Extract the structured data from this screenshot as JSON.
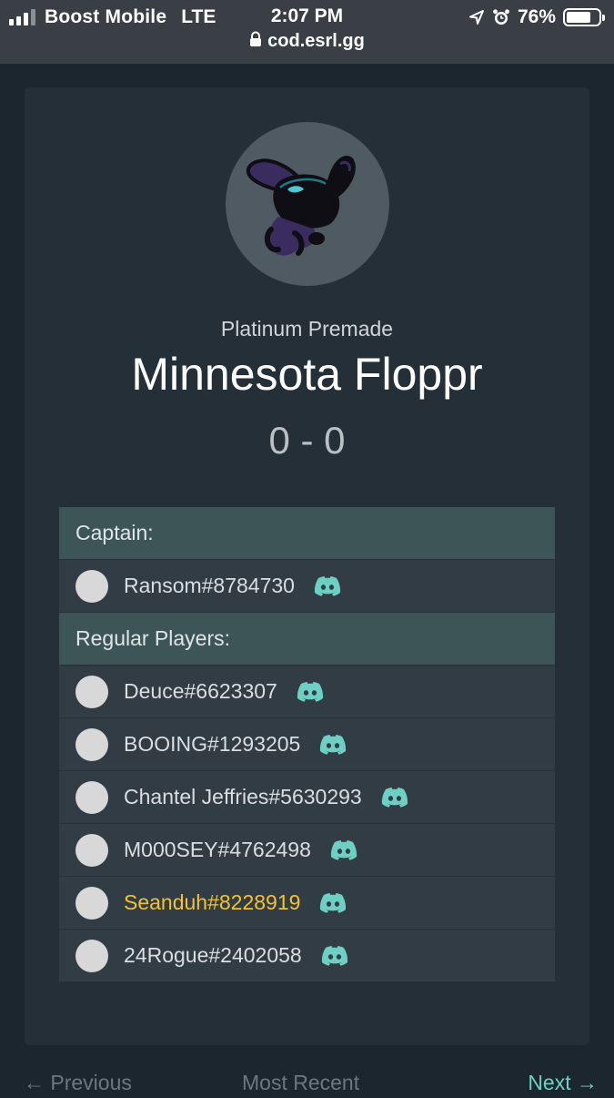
{
  "status_bar": {
    "carrier": "Boost Mobile",
    "network": "LTE",
    "time": "2:07 PM",
    "battery": "76%",
    "battery_level": 0.76,
    "url": "cod.esrl.gg"
  },
  "team": {
    "division": "Platinum Premade",
    "name": "Minnesota Floppr",
    "record": "0 - 0"
  },
  "roster": {
    "captain_header": "Captain:",
    "captain": {
      "name": "Ransom#8784730",
      "highlight": false
    },
    "players_header": "Regular Players:",
    "players": [
      {
        "name": "Deuce#6623307",
        "highlight": false
      },
      {
        "name": "BOOING#1293205",
        "highlight": false
      },
      {
        "name": "Chantel Jeffries#5630293",
        "highlight": false
      },
      {
        "name": "M000SEY#4762498",
        "highlight": false
      },
      {
        "name": "Seanduh#8228919",
        "highlight": true
      },
      {
        "name": "24Rogue#2402058",
        "highlight": false
      }
    ]
  },
  "pager": {
    "previous": "Previous",
    "most_recent": "Most Recent",
    "next": "Next"
  },
  "colors": {
    "accent": "#6ed0c4",
    "highlight": "#f2c230",
    "section_header": "#3e5558"
  }
}
